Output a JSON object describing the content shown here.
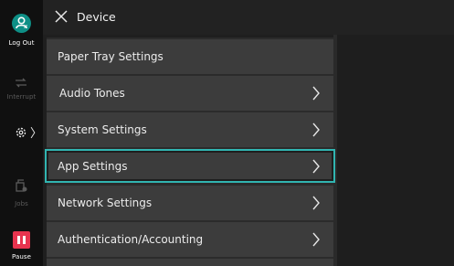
{
  "rail": {
    "logout_label": "Log Out",
    "interrupt_label": "Interrupt",
    "jobs_label": "Jobs",
    "pause_label": "Pause",
    "device_indicator": "〉"
  },
  "header": {
    "title": "Device"
  },
  "menu": [
    {
      "label": "Paper Tray Settings",
      "chevron": false,
      "selected": false
    },
    {
      "label": "Audio Tones",
      "chevron": true,
      "selected": false
    },
    {
      "label": "System Settings",
      "chevron": true,
      "selected": false
    },
    {
      "label": "App Settings",
      "chevron": true,
      "selected": true
    },
    {
      "label": "Network Settings",
      "chevron": true,
      "selected": false
    },
    {
      "label": "Authentication/Accounting",
      "chevron": true,
      "selected": false
    }
  ],
  "colors": {
    "accent": "#31b5b1",
    "logout": "#0e8f86",
    "pause": "#e8344f"
  }
}
